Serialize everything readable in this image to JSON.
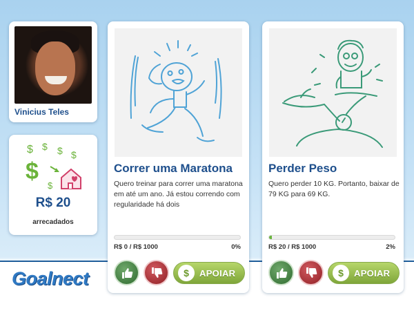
{
  "profile": {
    "name": "Vinicius Teles"
  },
  "raised": {
    "amount": "R$ 20",
    "label": "arrecadados"
  },
  "goals": [
    {
      "title": "Correr uma Maratona",
      "description": "Quero treinar para correr uma maratona em até um ano. Já estou correndo com regularidade há dois",
      "progress_text": "R$ 0 / R$ 1000",
      "progress_percent_text": "0%",
      "progress_fraction": 0.0,
      "support_label": "APOIAR",
      "illustration": "running-figure-sketch",
      "sketch_color": "#4fa3d6"
    },
    {
      "title": "Perder Peso",
      "description": "Quero perder 10 KG. Portanto, baixar de 79 KG para 69 KG.",
      "progress_text": "R$ 20 / R$ 1000",
      "progress_percent_text": "2%",
      "progress_fraction": 0.02,
      "support_label": "APOIAR",
      "illustration": "scale-figure-sketch",
      "sketch_color": "#3a9a78"
    }
  ],
  "logo": {
    "text": "Goalnect"
  },
  "colors": {
    "brand_blue": "#1e4f8c",
    "progress_green": "#6ab43e",
    "like_green": "#3f7d3c",
    "dislike_red": "#b03037",
    "support_green": "#9cc455"
  }
}
